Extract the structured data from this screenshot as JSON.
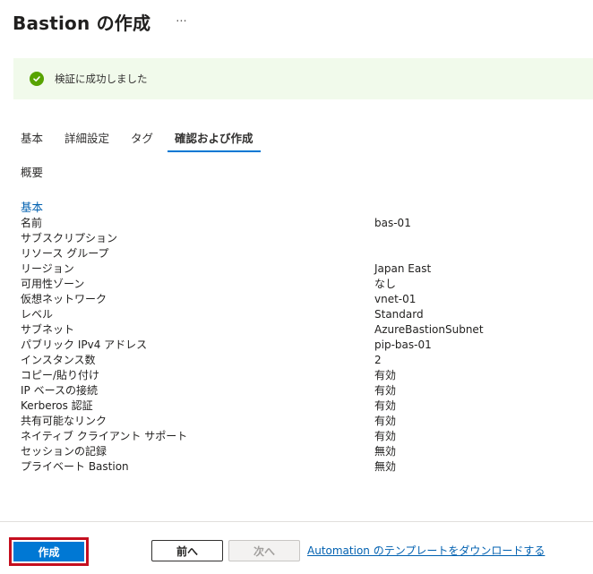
{
  "header": {
    "title": "Bastion の作成",
    "more_label": "···"
  },
  "banner": {
    "icon": "check-circle-icon",
    "text": "検証に成功しました",
    "color": "#57a300"
  },
  "tabs": [
    {
      "label": "基本",
      "active": false
    },
    {
      "label": "詳細設定",
      "active": false
    },
    {
      "label": "タグ",
      "active": false
    },
    {
      "label": "確認および作成",
      "active": true
    }
  ],
  "overview_label": "概要",
  "section_heading": "基本",
  "summary": [
    {
      "label": "名前",
      "value": "bas-01"
    },
    {
      "label": "サブスクリプション",
      "value": ""
    },
    {
      "label": "リソース グループ",
      "value": ""
    },
    {
      "label": "リージョン",
      "value": "Japan East"
    },
    {
      "label": "可用性ゾーン",
      "value": "なし"
    },
    {
      "label": "仮想ネットワーク",
      "value": "vnet-01"
    },
    {
      "label": "レベル",
      "value": "Standard"
    },
    {
      "label": "サブネット",
      "value": "AzureBastionSubnet"
    },
    {
      "label": "パブリック IPv4 アドレス",
      "value": "pip-bas-01"
    },
    {
      "label": "インスタンス数",
      "value": "2"
    },
    {
      "label": "コピー/貼り付け",
      "value": "有効"
    },
    {
      "label": "IP ベースの接続",
      "value": "有効"
    },
    {
      "label": "Kerberos 認証",
      "value": "有効"
    },
    {
      "label": "共有可能なリンク",
      "value": "有効"
    },
    {
      "label": "ネイティブ クライアント サポート",
      "value": "有効"
    },
    {
      "label": "セッションの記録",
      "value": "無効"
    },
    {
      "label": "プライベート Bastion",
      "value": "無効"
    }
  ],
  "footer": {
    "create_label": "作成",
    "prev_label": "前へ",
    "next_label": "次へ",
    "download_link": "Automation のテンプレートをダウンロードする"
  },
  "colors": {
    "accent": "#0078d4",
    "highlight_outline": "#c50f1f"
  }
}
